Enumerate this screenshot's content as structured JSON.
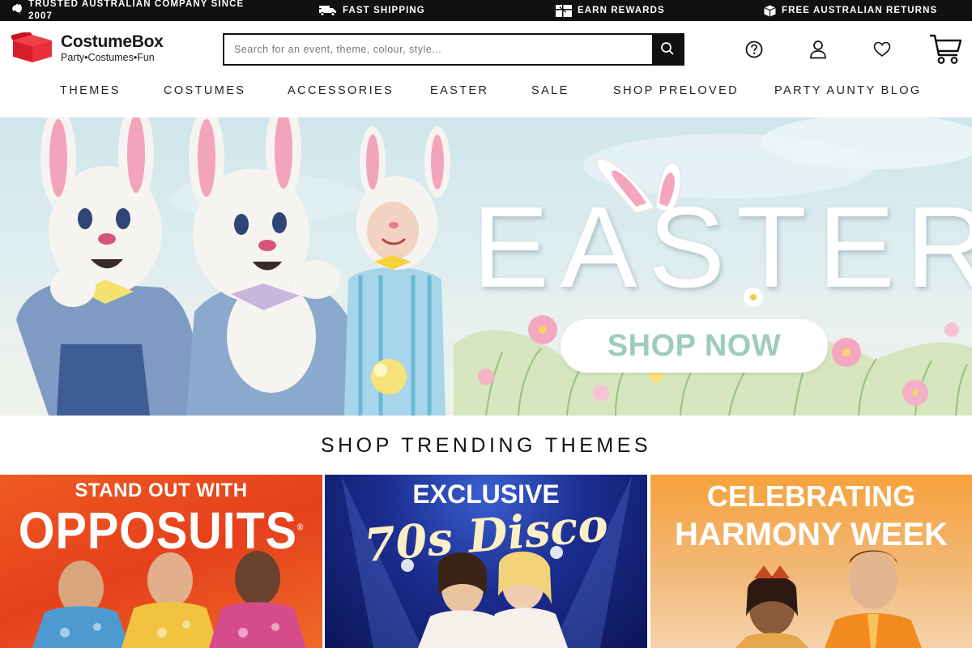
{
  "promo_bar": {
    "items": [
      {
        "icon": "australia-map-icon",
        "text": "TRUSTED AUSTRALIAN COMPANY SINCE 2007"
      },
      {
        "icon": "truck-icon",
        "text": "FAST SHIPPING"
      },
      {
        "icon": "gift-icon",
        "text": "EARN REWARDS"
      },
      {
        "icon": "box-icon",
        "text": "FREE AUSTRALIAN RETURNS"
      }
    ]
  },
  "header": {
    "logo": {
      "name": "CostumeBox",
      "tagline": "Party•Costumes•Fun"
    },
    "search": {
      "placeholder": "Search for an event, theme, colour, style..."
    },
    "icons": [
      "help-icon",
      "account-icon",
      "wishlist-icon",
      "cart-icon"
    ]
  },
  "nav": {
    "items": [
      "THEMES",
      "COSTUMES",
      "ACCESSORIES",
      "EASTER",
      "SALE",
      "SHOP PRELOVED",
      "PARTY AUNTY BLOG"
    ]
  },
  "hero": {
    "title": "EASTER",
    "cta": "SHOP NOW",
    "colors": {
      "cta_text": "#9dcdb9",
      "sky": "#cfe6ec"
    }
  },
  "trending": {
    "title": "SHOP TRENDING THEMES",
    "tiles": [
      {
        "line1": "STAND OUT WITH",
        "line2": "OPPOSUITS",
        "mark": "®"
      },
      {
        "line1": "EXCLUSIVE",
        "line2": "70s Disco"
      },
      {
        "line1": "CELEBRATING",
        "line2": "HARMONY WEEK"
      }
    ]
  }
}
